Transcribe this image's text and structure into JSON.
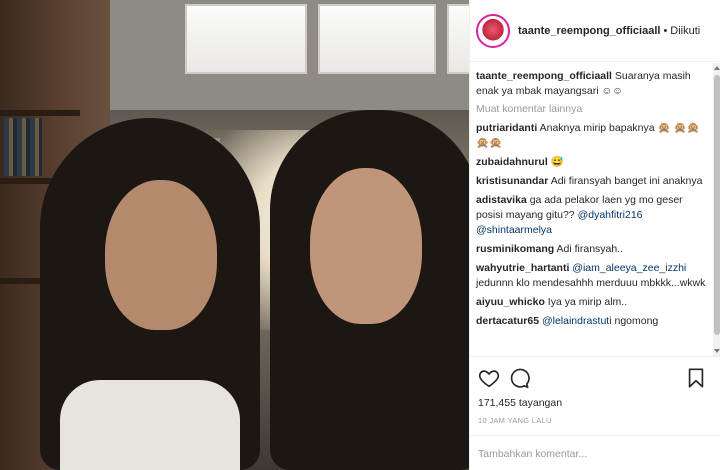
{
  "post": {
    "username": "taante_reempong_officiaall",
    "separator": "•",
    "follow_status": "Diikuti"
  },
  "caption": {
    "user": "taante_reempong_officiaall",
    "text": "Suaranya masih enak ya mbak mayangsari ☺☺"
  },
  "more_comments_label": "Muat komentar lainnya",
  "comments": [
    {
      "user": "putriaridanti",
      "pre": "Anaknya mirip bapaknya 🙊 🙊🙊🙊🙊",
      "mention": "",
      "post": ""
    },
    {
      "user": "zubaidahnurul",
      "pre": "😅",
      "mention": "",
      "post": ""
    },
    {
      "user": "kristisunandar",
      "pre": "Adi firansyah banget ini anaknya",
      "mention": "",
      "post": ""
    },
    {
      "user": "adistavika",
      "pre": "ga ada pelakor laen yg mo geser posisi mayang gitu??",
      "mention": "@dyahfitri216 @shintaarmelya",
      "post": ""
    },
    {
      "user": "rusminikomang",
      "pre": "Adi firansyah..",
      "mention": "",
      "post": ""
    },
    {
      "user": "wahyutrie_hartanti",
      "pre": "",
      "mention": "@iam_aleeya_zee_izzhi",
      "post": "jedunnn klo mendesahhh merduuu mbkkk...wkwk"
    },
    {
      "user": "aiyuu_whicko",
      "pre": "Iya ya mirip alm..",
      "mention": "",
      "post": ""
    },
    {
      "user": "dertacatur65",
      "pre": "",
      "mention": "@lelaindrastuti",
      "post": "ngomong"
    }
  ],
  "stats": {
    "views": "171,455 tayangan",
    "time_ago": "10 JAM YANG LALU"
  },
  "add_comment": {
    "placeholder": "Tambahkan komentar..."
  },
  "icons": {
    "like": "heart-icon",
    "comment": "comment-icon",
    "save": "bookmark-icon"
  }
}
